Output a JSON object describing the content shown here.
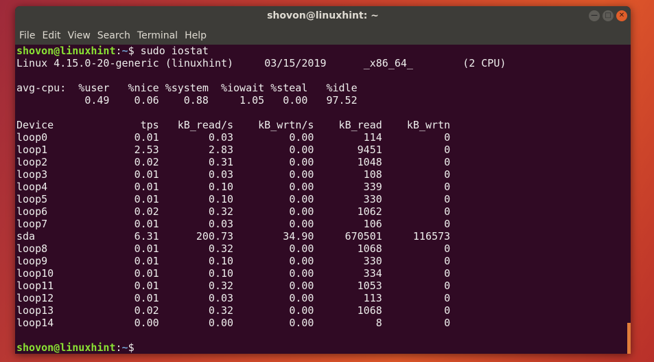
{
  "window": {
    "title": "shovon@linuxhint: ~"
  },
  "menu": [
    "File",
    "Edit",
    "View",
    "Search",
    "Terminal",
    "Help"
  ],
  "prompt": {
    "user_host": "shovon@linuxhint",
    "colon": ":",
    "path": "~",
    "symbol": "$ ",
    "command": "sudo iostat"
  },
  "sysinfo": {
    "kernel": "Linux 4.15.0-20-generic (linuxhint)",
    "date": "03/15/2019",
    "arch": "_x86_64_",
    "cpus": "(2 CPU)"
  },
  "cpu": {
    "label": "avg-cpu:",
    "headers": [
      "%user",
      "%nice",
      "%system",
      "%iowait",
      "%steal",
      "%idle"
    ],
    "values": [
      "0.49",
      "0.06",
      "0.88",
      "1.05",
      "0.00",
      "97.52"
    ]
  },
  "devices": {
    "headers": [
      "Device",
      "tps",
      "kB_read/s",
      "kB_wrtn/s",
      "kB_read",
      "kB_wrtn"
    ],
    "rows": [
      [
        "loop0",
        "0.01",
        "0.03",
        "0.00",
        "114",
        "0"
      ],
      [
        "loop1",
        "2.53",
        "2.83",
        "0.00",
        "9451",
        "0"
      ],
      [
        "loop2",
        "0.02",
        "0.31",
        "0.00",
        "1048",
        "0"
      ],
      [
        "loop3",
        "0.01",
        "0.03",
        "0.00",
        "108",
        "0"
      ],
      [
        "loop4",
        "0.01",
        "0.10",
        "0.00",
        "339",
        "0"
      ],
      [
        "loop5",
        "0.01",
        "0.10",
        "0.00",
        "330",
        "0"
      ],
      [
        "loop6",
        "0.02",
        "0.32",
        "0.00",
        "1062",
        "0"
      ],
      [
        "loop7",
        "0.01",
        "0.03",
        "0.00",
        "106",
        "0"
      ],
      [
        "sda",
        "6.31",
        "200.73",
        "34.90",
        "670501",
        "116573"
      ],
      [
        "loop8",
        "0.01",
        "0.32",
        "0.00",
        "1068",
        "0"
      ],
      [
        "loop9",
        "0.01",
        "0.10",
        "0.00",
        "330",
        "0"
      ],
      [
        "loop10",
        "0.01",
        "0.10",
        "0.00",
        "334",
        "0"
      ],
      [
        "loop11",
        "0.01",
        "0.32",
        "0.00",
        "1053",
        "0"
      ],
      [
        "loop12",
        "0.01",
        "0.03",
        "0.00",
        "113",
        "0"
      ],
      [
        "loop13",
        "0.02",
        "0.32",
        "0.00",
        "1068",
        "0"
      ],
      [
        "loop14",
        "0.00",
        "0.00",
        "0.00",
        "8",
        "0"
      ]
    ]
  }
}
